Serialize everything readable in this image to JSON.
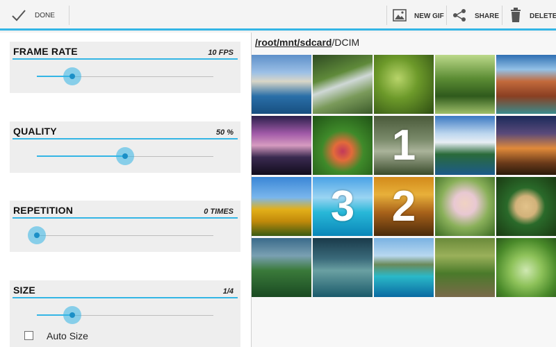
{
  "toolbar": {
    "done_label": "DONE",
    "actions": [
      {
        "label": "NEW GIF",
        "icon": "image-icon"
      },
      {
        "label": "SHARE",
        "icon": "share-icon"
      },
      {
        "label": "DELETE",
        "icon": "trash-icon"
      }
    ]
  },
  "settings": {
    "frame_rate": {
      "title": "FRAME RATE",
      "value": "10 FPS",
      "slider_level": 0.2
    },
    "quality": {
      "title": "QUALITY",
      "value": "50 %",
      "slider_level": 0.5
    },
    "repetition": {
      "title": "REPETITION",
      "value": "0 TIMES",
      "slider_level": 0.0
    },
    "size": {
      "title": "SIZE",
      "value": "1/4",
      "slider_level": 0.2,
      "auto_size_label": "Auto Size",
      "auto_size_checked": false
    }
  },
  "browser": {
    "path_segment": "/root/mnt/sdcard",
    "path_rest": "/DCIM",
    "thumbnails": [
      {
        "name": "cliffs-kayaks",
        "selection": ""
      },
      {
        "name": "waterfall-steps",
        "selection": ""
      },
      {
        "name": "green-leaves",
        "selection": ""
      },
      {
        "name": "forest-path-cyclists",
        "selection": ""
      },
      {
        "name": "red-canyon-river",
        "selection": ""
      },
      {
        "name": "purple-sunset-lake",
        "selection": ""
      },
      {
        "name": "flower-garden",
        "selection": ""
      },
      {
        "name": "garden-statue",
        "selection": "1"
      },
      {
        "name": "mountain-lake",
        "selection": ""
      },
      {
        "name": "sunset-sky",
        "selection": ""
      },
      {
        "name": "sunflower-field",
        "selection": ""
      },
      {
        "name": "island-beach",
        "selection": "3"
      },
      {
        "name": "autumn-forest",
        "selection": "2"
      },
      {
        "name": "laughing-child",
        "selection": ""
      },
      {
        "name": "heart-lake",
        "selection": ""
      },
      {
        "name": "jungle-waterfall",
        "selection": ""
      },
      {
        "name": "tree-island",
        "selection": ""
      },
      {
        "name": "coastal-bay",
        "selection": ""
      },
      {
        "name": "man-with-dog",
        "selection": ""
      },
      {
        "name": "succulent-plant",
        "selection": ""
      }
    ]
  },
  "colors": {
    "accent": "#33b5e5"
  }
}
